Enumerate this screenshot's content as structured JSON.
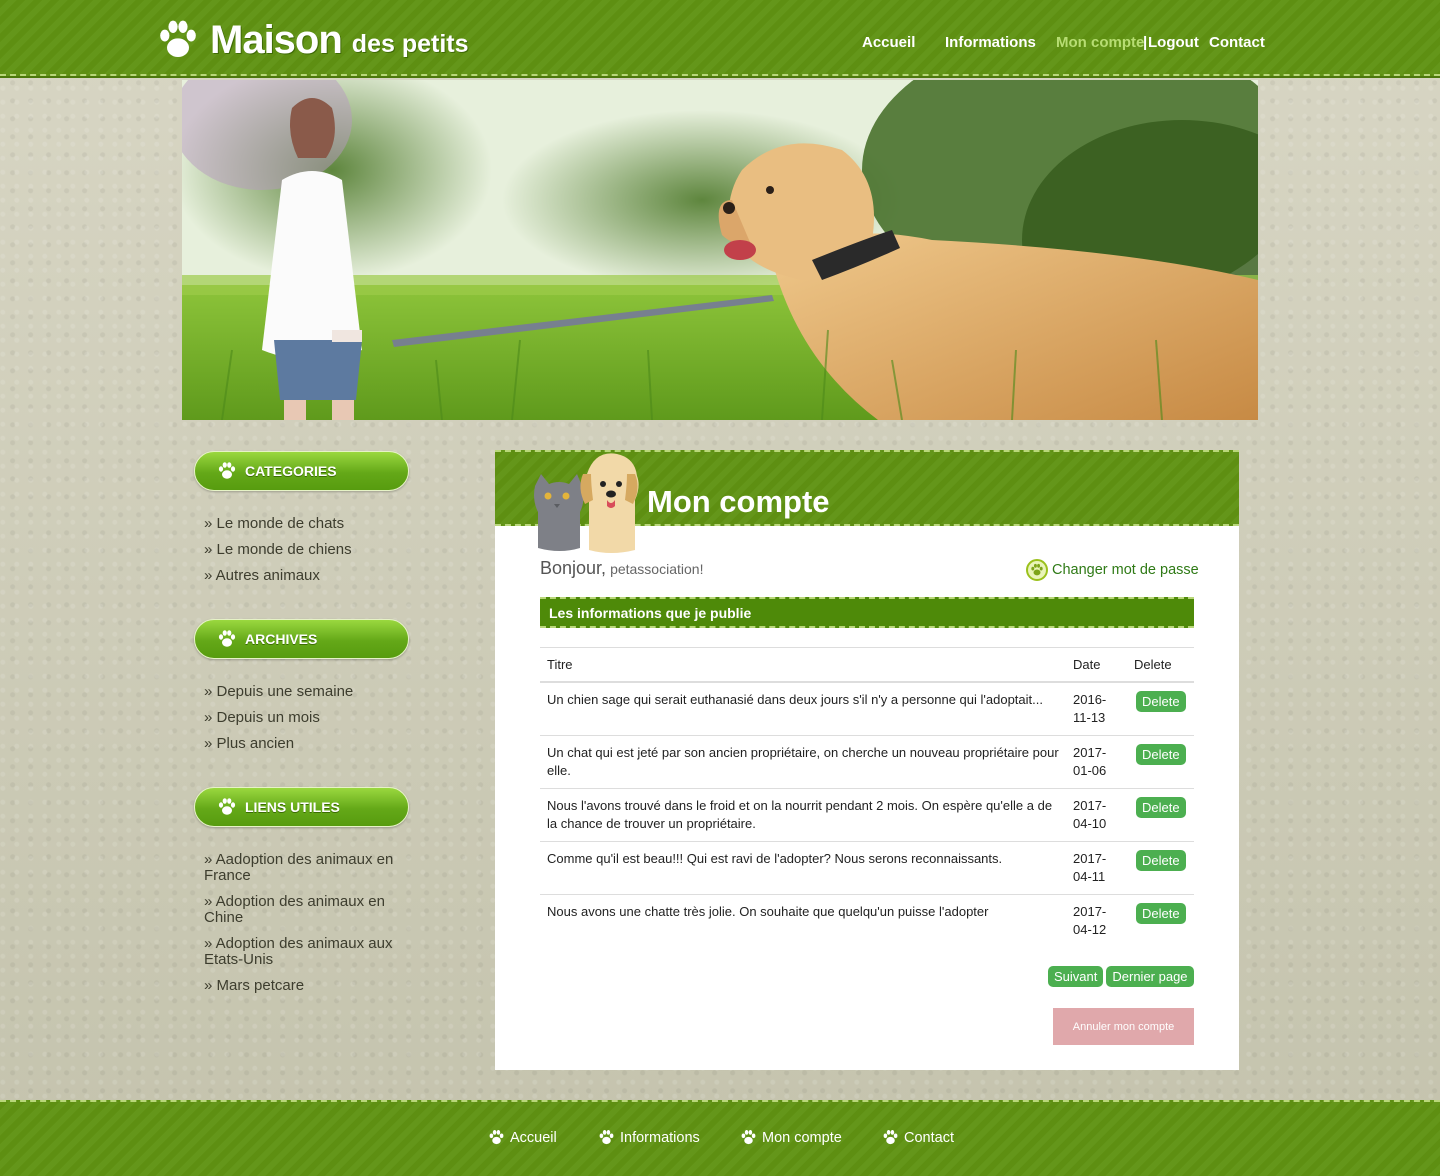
{
  "site": {
    "logo_main": "Maison",
    "logo_sub": "des petits"
  },
  "topnav": {
    "home": "Accueil",
    "info": "Informations",
    "account": "Mon compte",
    "separator": "|",
    "logout": "Logout",
    "contact": "Contact"
  },
  "sidebar": {
    "categories": {
      "title": "CATEGORIES",
      "items": [
        "» Le monde de chats",
        "» Le monde de chiens",
        "» Autres animaux"
      ]
    },
    "archives": {
      "title": "ARCHIVES",
      "items": [
        "» Depuis une semaine",
        "» Depuis un mois",
        "» Plus ancien"
      ]
    },
    "links": {
      "title": "LIENS UTILES",
      "items": [
        "» Aadoption des animaux en France",
        "» Adoption des animaux en Chine",
        "» Adoption des animaux aux Etats-Unis",
        "» Mars petcare"
      ]
    }
  },
  "main": {
    "title": "Mon compte",
    "greeting": "Bonjour,",
    "username": "petassociation!",
    "change_password": "Changer mot de passe",
    "section_title": "Les informations que je publie",
    "table": {
      "headers": [
        "Titre",
        "Date",
        "Delete"
      ],
      "rows": [
        {
          "title": "Un chien sage qui serait euthanasié dans deux jours s'il n'y a personne qui l'adoptait...",
          "date": "2016-11-13",
          "action": "Delete"
        },
        {
          "title": "Un chat qui est jeté par son ancien propriétaire, on cherche un nouveau propriétaire pour elle.",
          "date": "2017-01-06",
          "action": "Delete"
        },
        {
          "title": "Nous l'avons trouvé dans le froid et on la nourrit pendant 2 mois. On espère qu'elle a de la chance de trouver un propriétaire.",
          "date": "2017-04-10",
          "action": "Delete"
        },
        {
          "title": "Comme qu'il est beau!!! Qui est ravi de l'adopter? Nous serons reconnaissants.",
          "date": "2017-04-11",
          "action": "Delete"
        },
        {
          "title": "Nous avons une chatte très jolie. On souhaite que quelqu'un puisse l'adopter",
          "date": "2017-04-12",
          "action": "Delete"
        }
      ]
    },
    "pager": {
      "next": "Suivant",
      "last": "Dernier page"
    },
    "cancel_account": "Annuler mon compte"
  },
  "footer": {
    "home": "Accueil",
    "info": "Informations",
    "account": "Mon compte",
    "contact": "Contact"
  },
  "colors": {
    "brand_green": "#5e8f12",
    "accent_light_green": "#b7dd73",
    "button_green": "#4caf50",
    "cancel_pink": "#e0a8ab"
  }
}
